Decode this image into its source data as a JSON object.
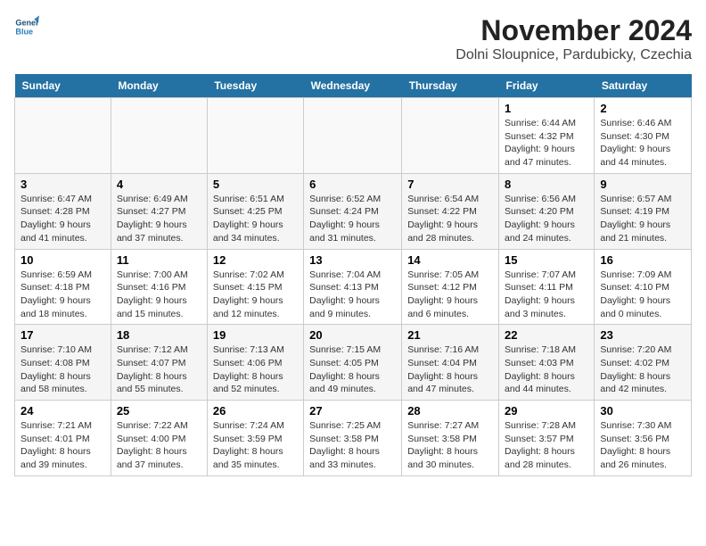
{
  "logo": {
    "line1": "General",
    "line2": "Blue"
  },
  "title": "November 2024",
  "subtitle": "Dolni Sloupnice, Pardubicky, Czechia",
  "days_of_week": [
    "Sunday",
    "Monday",
    "Tuesday",
    "Wednesday",
    "Thursday",
    "Friday",
    "Saturday"
  ],
  "weeks": [
    [
      {
        "day": "",
        "info": ""
      },
      {
        "day": "",
        "info": ""
      },
      {
        "day": "",
        "info": ""
      },
      {
        "day": "",
        "info": ""
      },
      {
        "day": "",
        "info": ""
      },
      {
        "day": "1",
        "info": "Sunrise: 6:44 AM\nSunset: 4:32 PM\nDaylight: 9 hours and 47 minutes."
      },
      {
        "day": "2",
        "info": "Sunrise: 6:46 AM\nSunset: 4:30 PM\nDaylight: 9 hours and 44 minutes."
      }
    ],
    [
      {
        "day": "3",
        "info": "Sunrise: 6:47 AM\nSunset: 4:28 PM\nDaylight: 9 hours and 41 minutes."
      },
      {
        "day": "4",
        "info": "Sunrise: 6:49 AM\nSunset: 4:27 PM\nDaylight: 9 hours and 37 minutes."
      },
      {
        "day": "5",
        "info": "Sunrise: 6:51 AM\nSunset: 4:25 PM\nDaylight: 9 hours and 34 minutes."
      },
      {
        "day": "6",
        "info": "Sunrise: 6:52 AM\nSunset: 4:24 PM\nDaylight: 9 hours and 31 minutes."
      },
      {
        "day": "7",
        "info": "Sunrise: 6:54 AM\nSunset: 4:22 PM\nDaylight: 9 hours and 28 minutes."
      },
      {
        "day": "8",
        "info": "Sunrise: 6:56 AM\nSunset: 4:20 PM\nDaylight: 9 hours and 24 minutes."
      },
      {
        "day": "9",
        "info": "Sunrise: 6:57 AM\nSunset: 4:19 PM\nDaylight: 9 hours and 21 minutes."
      }
    ],
    [
      {
        "day": "10",
        "info": "Sunrise: 6:59 AM\nSunset: 4:18 PM\nDaylight: 9 hours and 18 minutes."
      },
      {
        "day": "11",
        "info": "Sunrise: 7:00 AM\nSunset: 4:16 PM\nDaylight: 9 hours and 15 minutes."
      },
      {
        "day": "12",
        "info": "Sunrise: 7:02 AM\nSunset: 4:15 PM\nDaylight: 9 hours and 12 minutes."
      },
      {
        "day": "13",
        "info": "Sunrise: 7:04 AM\nSunset: 4:13 PM\nDaylight: 9 hours and 9 minutes."
      },
      {
        "day": "14",
        "info": "Sunrise: 7:05 AM\nSunset: 4:12 PM\nDaylight: 9 hours and 6 minutes."
      },
      {
        "day": "15",
        "info": "Sunrise: 7:07 AM\nSunset: 4:11 PM\nDaylight: 9 hours and 3 minutes."
      },
      {
        "day": "16",
        "info": "Sunrise: 7:09 AM\nSunset: 4:10 PM\nDaylight: 9 hours and 0 minutes."
      }
    ],
    [
      {
        "day": "17",
        "info": "Sunrise: 7:10 AM\nSunset: 4:08 PM\nDaylight: 8 hours and 58 minutes."
      },
      {
        "day": "18",
        "info": "Sunrise: 7:12 AM\nSunset: 4:07 PM\nDaylight: 8 hours and 55 minutes."
      },
      {
        "day": "19",
        "info": "Sunrise: 7:13 AM\nSunset: 4:06 PM\nDaylight: 8 hours and 52 minutes."
      },
      {
        "day": "20",
        "info": "Sunrise: 7:15 AM\nSunset: 4:05 PM\nDaylight: 8 hours and 49 minutes."
      },
      {
        "day": "21",
        "info": "Sunrise: 7:16 AM\nSunset: 4:04 PM\nDaylight: 8 hours and 47 minutes."
      },
      {
        "day": "22",
        "info": "Sunrise: 7:18 AM\nSunset: 4:03 PM\nDaylight: 8 hours and 44 minutes."
      },
      {
        "day": "23",
        "info": "Sunrise: 7:20 AM\nSunset: 4:02 PM\nDaylight: 8 hours and 42 minutes."
      }
    ],
    [
      {
        "day": "24",
        "info": "Sunrise: 7:21 AM\nSunset: 4:01 PM\nDaylight: 8 hours and 39 minutes."
      },
      {
        "day": "25",
        "info": "Sunrise: 7:22 AM\nSunset: 4:00 PM\nDaylight: 8 hours and 37 minutes."
      },
      {
        "day": "26",
        "info": "Sunrise: 7:24 AM\nSunset: 3:59 PM\nDaylight: 8 hours and 35 minutes."
      },
      {
        "day": "27",
        "info": "Sunrise: 7:25 AM\nSunset: 3:58 PM\nDaylight: 8 hours and 33 minutes."
      },
      {
        "day": "28",
        "info": "Sunrise: 7:27 AM\nSunset: 3:58 PM\nDaylight: 8 hours and 30 minutes."
      },
      {
        "day": "29",
        "info": "Sunrise: 7:28 AM\nSunset: 3:57 PM\nDaylight: 8 hours and 28 minutes."
      },
      {
        "day": "30",
        "info": "Sunrise: 7:30 AM\nSunset: 3:56 PM\nDaylight: 8 hours and 26 minutes."
      }
    ]
  ]
}
